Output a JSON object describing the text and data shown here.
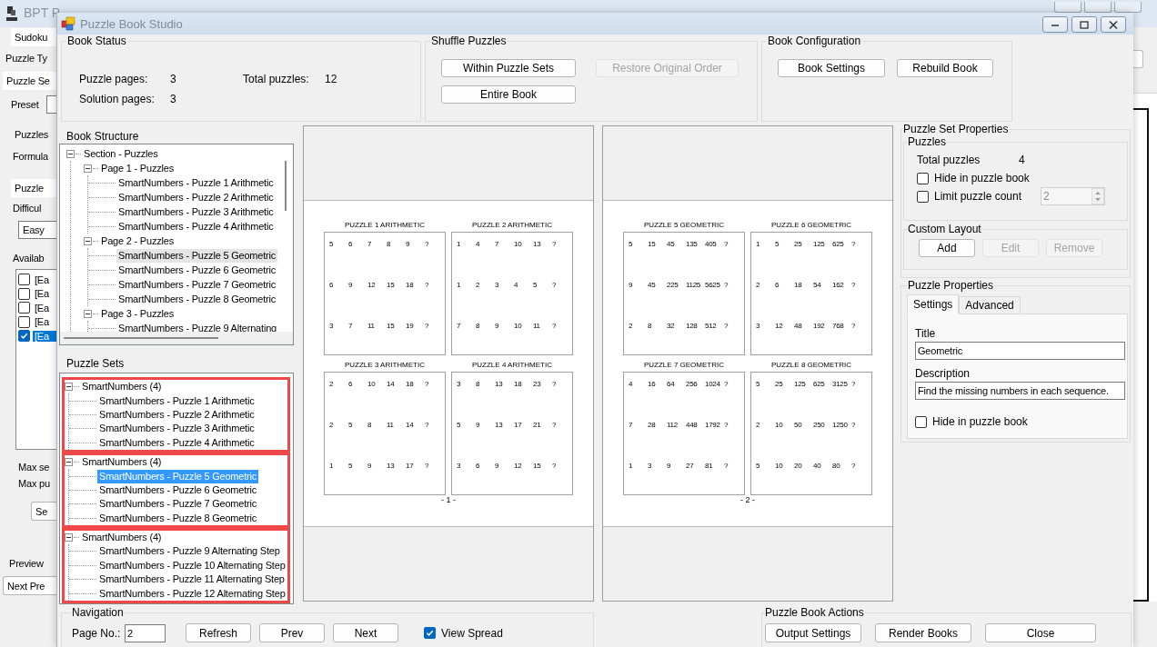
{
  "background_window": {
    "title": "BPT P",
    "items": [
      {
        "kind": "tab",
        "text": "Sudoku"
      },
      {
        "kind": "label",
        "text": "Puzzle Ty"
      },
      {
        "kind": "tab",
        "text": "Puzzle Se"
      },
      {
        "kind": "label_field",
        "text": "Preset"
      },
      {
        "kind": "label",
        "text": "Puzzles"
      },
      {
        "kind": "label",
        "text": "Formula"
      },
      {
        "kind": "tab",
        "text": "Puzzle"
      },
      {
        "kind": "group",
        "text": "Difficul"
      },
      {
        "kind": "field",
        "text": "Easy"
      },
      {
        "kind": "group",
        "text": "Availab"
      },
      {
        "kind": "checklist",
        "items": [
          {
            "text": "[Ea",
            "checked": false,
            "selected": false
          },
          {
            "text": "[Ea",
            "checked": false,
            "selected": false
          },
          {
            "text": "[Ea",
            "checked": false,
            "selected": false
          },
          {
            "text": "[Ea",
            "checked": false,
            "selected": false
          },
          {
            "text": "[Ea",
            "checked": true,
            "selected": true
          }
        ]
      },
      {
        "kind": "label",
        "text": "Max se"
      },
      {
        "kind": "label",
        "text": "Max pu"
      },
      {
        "kind": "button",
        "text": "Se"
      },
      {
        "kind": "group",
        "text": "Preview"
      },
      {
        "kind": "button",
        "text": "Next Pre"
      }
    ]
  },
  "dialog": {
    "title": "Puzzle Book Studio"
  },
  "book_status": {
    "title": "Book Status",
    "stats": [
      {
        "label": "Puzzle pages:",
        "value": "3"
      },
      {
        "label": "Total puzzles:",
        "value": "12"
      },
      {
        "label": "Solution pages:",
        "value": "3"
      }
    ]
  },
  "shuffle": {
    "title": "Shuffle Puzzles",
    "buttons": [
      {
        "label": "Within Puzzle Sets",
        "disabled": false
      },
      {
        "label": "Restore Original Order",
        "disabled": true
      },
      {
        "label": "Entire Book",
        "disabled": false
      }
    ]
  },
  "book_configuration": {
    "title": "Book Configuration",
    "buttons": [
      {
        "label": "Book Settings",
        "disabled": false
      },
      {
        "label": "Rebuild Book",
        "disabled": false
      }
    ]
  },
  "book_structure": {
    "title": "Book Structure",
    "focused": false,
    "nodes": [
      {
        "label": "Section - Puzzles",
        "expanded": true,
        "selected": false,
        "children": [
          {
            "label": "Page 1 - Puzzles",
            "expanded": true,
            "selected": false,
            "children": [
              {
                "label": "SmartNumbers - Puzzle 1 Arithmetic",
                "selected": false
              },
              {
                "label": "SmartNumbers - Puzzle 2 Arithmetic",
                "selected": false
              },
              {
                "label": "SmartNumbers - Puzzle 3 Arithmetic",
                "selected": false
              },
              {
                "label": "SmartNumbers - Puzzle 4 Arithmetic",
                "selected": false
              }
            ]
          },
          {
            "label": "Page 2 - Puzzles",
            "expanded": true,
            "selected": false,
            "children": [
              {
                "label": "SmartNumbers - Puzzle 5 Geometric",
                "selected": true
              },
              {
                "label": "SmartNumbers - Puzzle 6 Geometric",
                "selected": false
              },
              {
                "label": "SmartNumbers - Puzzle 7 Geometric",
                "selected": false
              },
              {
                "label": "SmartNumbers - Puzzle 8 Geometric",
                "selected": false
              }
            ]
          },
          {
            "label": "Page 3 - Puzzles",
            "expanded": true,
            "selected": false,
            "children": [
              {
                "label": "SmartNumbers - Puzzle 9 Alternating",
                "selected": false
              }
            ]
          }
        ]
      }
    ]
  },
  "puzzle_sets": {
    "title": "Puzzle Sets",
    "focused": true,
    "nodes": [
      {
        "label": "SmartNumbers (4)",
        "expanded": true,
        "highlighted": true,
        "selected": false,
        "children": [
          {
            "label": "SmartNumbers - Puzzle 1 Arithmetic",
            "selected": false
          },
          {
            "label": "SmartNumbers - Puzzle 2 Arithmetic",
            "selected": false
          },
          {
            "label": "SmartNumbers - Puzzle 3 Arithmetic",
            "selected": false
          },
          {
            "label": "SmartNumbers - Puzzle 4 Arithmetic",
            "selected": false
          }
        ]
      },
      {
        "label": "SmartNumbers (4)",
        "expanded": true,
        "highlighted": true,
        "selected": false,
        "children": [
          {
            "label": "SmartNumbers - Puzzle 5 Geometric",
            "selected": true
          },
          {
            "label": "SmartNumbers - Puzzle 6 Geometric",
            "selected": false
          },
          {
            "label": "SmartNumbers - Puzzle 7 Geometric",
            "selected": false
          },
          {
            "label": "SmartNumbers - Puzzle 8 Geometric",
            "selected": false
          }
        ]
      },
      {
        "label": "SmartNumbers (4)",
        "expanded": true,
        "highlighted": true,
        "selected": false,
        "children": [
          {
            "label": "SmartNumbers - Puzzle 9 Alternating Step",
            "selected": false
          },
          {
            "label": "SmartNumbers - Puzzle 10 Alternating Step",
            "selected": false
          },
          {
            "label": "SmartNumbers - Puzzle 11 Alternating Step",
            "selected": false
          },
          {
            "label": "SmartNumbers - Puzzle 12 Alternating Step",
            "selected": false
          }
        ]
      }
    ]
  },
  "pages": [
    {
      "number": "- 1 -",
      "puzzles": [
        {
          "title": "PUZZLE 1 ARITHMETIC",
          "rows": [
            [
              "5",
              "6",
              "7",
              "8",
              "9",
              "?"
            ],
            [
              "6",
              "9",
              "12",
              "15",
              "18",
              "?"
            ],
            [
              "3",
              "7",
              "11",
              "15",
              "19",
              "?"
            ]
          ]
        },
        {
          "title": "PUZZLE 2 ARITHMETIC",
          "rows": [
            [
              "1",
              "4",
              "7",
              "10",
              "13",
              "?"
            ],
            [
              "1",
              "2",
              "3",
              "4",
              "5",
              "?"
            ],
            [
              "7",
              "8",
              "9",
              "10",
              "11",
              "?"
            ]
          ]
        },
        {
          "title": "PUZZLE 3 ARITHMETIC",
          "rows": [
            [
              "2",
              "6",
              "10",
              "14",
              "18",
              "?"
            ],
            [
              "2",
              "5",
              "8",
              "11",
              "14",
              "?"
            ],
            [
              "1",
              "5",
              "9",
              "13",
              "17",
              "?"
            ]
          ]
        },
        {
          "title": "PUZZLE 4 ARITHMETIC",
          "rows": [
            [
              "3",
              "8",
              "13",
              "18",
              "23",
              "?"
            ],
            [
              "5",
              "9",
              "13",
              "17",
              "21",
              "?"
            ],
            [
              "3",
              "6",
              "9",
              "12",
              "15",
              "?"
            ]
          ]
        }
      ]
    },
    {
      "number": "- 2 -",
      "puzzles": [
        {
          "title": "PUZZLE 5 GEOMETRIC",
          "rows": [
            [
              "5",
              "15",
              "45",
              "135",
              "405",
              "?"
            ],
            [
              "9",
              "45",
              "225",
              "1125",
              "5625",
              "?"
            ],
            [
              "2",
              "8",
              "32",
              "128",
              "512",
              "?"
            ]
          ]
        },
        {
          "title": "PUZZLE 6 GEOMETRIC",
          "rows": [
            [
              "1",
              "5",
              "25",
              "125",
              "625",
              "?"
            ],
            [
              "2",
              "6",
              "18",
              "54",
              "162",
              "?"
            ],
            [
              "3",
              "12",
              "48",
              "192",
              "768",
              "?"
            ]
          ]
        },
        {
          "title": "PUZZLE 7 GEOMETRIC",
          "rows": [
            [
              "4",
              "16",
              "64",
              "256",
              "1024",
              "?"
            ],
            [
              "7",
              "28",
              "112",
              "448",
              "1792",
              "?"
            ],
            [
              "1",
              "3",
              "9",
              "27",
              "81",
              "?"
            ]
          ]
        },
        {
          "title": "PUZZLE 8 GEOMETRIC",
          "rows": [
            [
              "5",
              "25",
              "125",
              "625",
              "3125",
              "?"
            ],
            [
              "2",
              "10",
              "50",
              "250",
              "1250",
              "?"
            ],
            [
              "5",
              "10",
              "20",
              "40",
              "80",
              "?"
            ]
          ]
        }
      ]
    }
  ],
  "puzzle_set_properties": {
    "title": "Puzzle Set Properties",
    "puzzles_group": {
      "title": "Puzzles",
      "total_label": "Total puzzles",
      "total_value": "4",
      "hide": {
        "label": "Hide in puzzle book",
        "checked": false
      },
      "limit": {
        "label": "Limit puzzle count",
        "checked": false
      },
      "limit_count": {
        "value": "2",
        "disabled": true
      }
    },
    "custom_layout": {
      "title": "Custom Layout",
      "buttons": [
        {
          "label": "Add",
          "disabled": false
        },
        {
          "label": "Edit",
          "disabled": true
        },
        {
          "label": "Remove",
          "disabled": true
        }
      ]
    }
  },
  "puzzle_properties": {
    "title": "Puzzle Properties",
    "tabs": [
      {
        "label": "Settings",
        "selected": true
      },
      {
        "label": "Advanced",
        "selected": false
      }
    ],
    "fields": [
      {
        "label": "Title",
        "value": "Geometric"
      },
      {
        "label": "Description",
        "value": "Find the missing numbers in each sequence."
      }
    ],
    "hide": {
      "label": "Hide in puzzle book",
      "checked": false
    }
  },
  "navigation": {
    "title": "Navigation",
    "page_label": "Page No.:",
    "page_value": "2",
    "buttons": [
      {
        "label": "Refresh",
        "disabled": false
      },
      {
        "label": "Prev",
        "disabled": false
      },
      {
        "label": "Next",
        "disabled": false
      }
    ],
    "view_spread": {
      "label": "View Spread",
      "checked": true
    }
  },
  "actions": {
    "title": "Puzzle Book Actions",
    "buttons": [
      {
        "label": "Output Settings",
        "disabled": false
      },
      {
        "label": "Render Books",
        "disabled": false
      },
      {
        "label": "Close",
        "disabled": false
      }
    ]
  }
}
